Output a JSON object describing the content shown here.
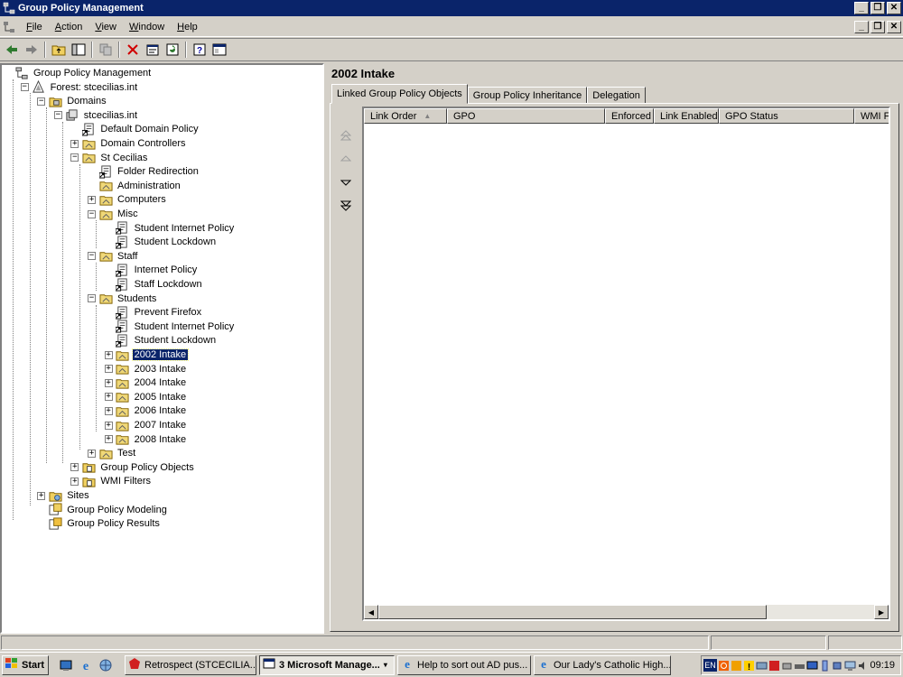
{
  "window": {
    "title": "Group Policy Management"
  },
  "menu": {
    "items": [
      {
        "label": "File",
        "ul": "F",
        "rest": "ile"
      },
      {
        "label": "Action",
        "ul": "A",
        "rest": "ction"
      },
      {
        "label": "View",
        "ul": "V",
        "rest": "iew"
      },
      {
        "label": "Window",
        "ul": "W",
        "rest": "indow"
      },
      {
        "label": "Help",
        "ul": "H",
        "rest": "elp"
      }
    ]
  },
  "tree": {
    "nodes": [
      {
        "label": "Group Policy Management",
        "icon": "gpm-icon",
        "expander": "none"
      },
      {
        "label": "Forest: stcecilias.int",
        "icon": "forest-icon",
        "expander": "minus"
      },
      {
        "label": "Domains",
        "icon": "domains-folder-icon",
        "expander": "minus"
      },
      {
        "label": "stcecilias.int",
        "icon": "domain-icon",
        "expander": "minus"
      },
      {
        "label": "Default Domain Policy",
        "icon": "gpo-link-icon",
        "expander": "none"
      },
      {
        "label": "Domain Controllers",
        "icon": "ou-folder-icon",
        "expander": "plus"
      },
      {
        "label": "St Cecilias",
        "icon": "ou-folder-icon",
        "expander": "minus"
      },
      {
        "label": "Folder Redirection",
        "icon": "gpo-link-icon",
        "expander": "none"
      },
      {
        "label": "Administration",
        "icon": "ou-folder-icon",
        "expander": "none"
      },
      {
        "label": "Computers",
        "icon": "ou-folder-icon",
        "expander": "plus"
      },
      {
        "label": "Misc",
        "icon": "ou-folder-icon",
        "expander": "minus"
      },
      {
        "label": "Student Internet Policy",
        "icon": "gpo-link-icon",
        "expander": "none"
      },
      {
        "label": "Student Lockdown",
        "icon": "gpo-link-icon",
        "expander": "none"
      },
      {
        "label": "Staff",
        "icon": "ou-folder-icon",
        "expander": "minus"
      },
      {
        "label": "Internet Policy",
        "icon": "gpo-link-icon",
        "expander": "none"
      },
      {
        "label": "Staff Lockdown",
        "icon": "gpo-link-icon",
        "expander": "none"
      },
      {
        "label": "Students",
        "icon": "ou-folder-icon",
        "expander": "minus"
      },
      {
        "label": "Prevent Firefox",
        "icon": "gpo-link-icon",
        "expander": "none"
      },
      {
        "label": "Student Internet Policy",
        "icon": "gpo-link-icon",
        "expander": "none"
      },
      {
        "label": "Student Lockdown",
        "icon": "gpo-link-icon",
        "expander": "none"
      },
      {
        "label": "2002 Intake",
        "icon": "ou-folder-icon",
        "expander": "plus",
        "selected": true
      },
      {
        "label": "2003 Intake",
        "icon": "ou-folder-icon",
        "expander": "plus"
      },
      {
        "label": "2004 Intake",
        "icon": "ou-folder-icon",
        "expander": "plus"
      },
      {
        "label": "2005 Intake",
        "icon": "ou-folder-icon",
        "expander": "plus"
      },
      {
        "label": "2006 Intake",
        "icon": "ou-folder-icon",
        "expander": "plus"
      },
      {
        "label": "2007 Intake",
        "icon": "ou-folder-icon",
        "expander": "plus"
      },
      {
        "label": "2008 Intake",
        "icon": "ou-folder-icon",
        "expander": "plus"
      },
      {
        "label": "Test",
        "icon": "ou-folder-icon",
        "expander": "plus"
      },
      {
        "label": "Group Policy Objects",
        "icon": "gpo-container-icon",
        "expander": "plus"
      },
      {
        "label": "WMI Filters",
        "icon": "gpo-container-icon",
        "expander": "plus"
      },
      {
        "label": "Sites",
        "icon": "sites-folder-icon",
        "expander": "plus"
      },
      {
        "label": "Group Policy Modeling",
        "icon": "modeling-icon",
        "expander": "none"
      },
      {
        "label": "Group Policy Results",
        "icon": "results-icon",
        "expander": "none"
      }
    ]
  },
  "details": {
    "title": "2002 Intake",
    "tabs": [
      "Linked Group Policy Objects",
      "Group Policy Inheritance",
      "Delegation"
    ],
    "active_tab": 0,
    "columns": [
      "Link Order",
      "GPO",
      "Enforced",
      "Link Enabled",
      "GPO Status",
      "WMI F"
    ],
    "sort_column": "Link Order",
    "rows": []
  },
  "taskbar": {
    "start_label": "Start",
    "tasks": [
      {
        "label": "Retrospect (STCECILIA...",
        "icon": "retrospect-icon",
        "active": false
      },
      {
        "label": "3 Microsoft Manage...",
        "icon": "mmc-icon",
        "active": true
      },
      {
        "label": "Help to sort out AD pus...",
        "icon": "ie-icon",
        "active": false
      },
      {
        "label": "Our Lady's Catholic High...",
        "icon": "ie-icon",
        "active": false
      }
    ],
    "lang": "EN",
    "time": "09:19"
  }
}
